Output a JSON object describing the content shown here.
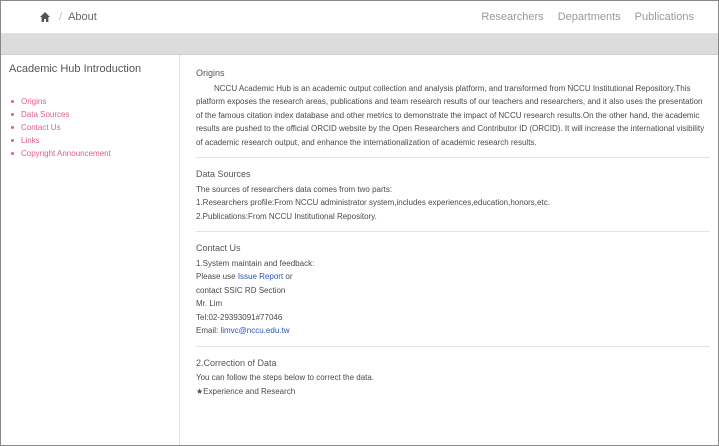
{
  "header": {
    "icons": {
      "home": "home-icon"
    },
    "breadcrumb_sep": "/",
    "breadcrumb": "About",
    "nav": [
      "Researchers",
      "Departments",
      "Publications"
    ]
  },
  "sidebar": {
    "title": "Academic Hub Introduction",
    "items": [
      {
        "label": "Origins"
      },
      {
        "label": "Data Sources"
      },
      {
        "label": "Contact Us"
      },
      {
        "label": "Links"
      },
      {
        "label": "Copyright Announcement"
      }
    ],
    "link_color": "#e05a93"
  },
  "sections": {
    "origins": {
      "title": "Origins",
      "text": "NCCU Academic Hub is an academic output collection and analysis platform, and transformed from NCCU Institutional Repository.This platform exposes the research areas, publications and team research results of our teachers and researchers, and it also uses the presentation of the famous citation index database and other metrics to demonstrate the impact of NCCU research results.On the other hand, the academic results are pushed to the official ORCID website by the Open Researchers and Contributor ID (ORCID). It will increase the international visibility of academic research output, and enhance the internationalization of academic research results."
    },
    "data_sources": {
      "title": "Data Sources",
      "lines": [
        "The sources of researchers data comes from two parts:",
        "1.Researchers profile:From NCCU administrator system,includes experiences,education,honors,etc.",
        "2.Publications:From NCCU Institutional Repository."
      ]
    },
    "contact": {
      "title": "Contact Us",
      "line1": "1.System maintain and feedback:",
      "use_prefix": "Please use ",
      "issue_link": "Issue Report",
      "use_suffix": " or",
      "line3": "contact SSIC RD Section",
      "line4": "Mr. Lim",
      "line5": "Tel:02-29393091#77046",
      "email_prefix": "Email: ",
      "email": "limvc@nccu.edu.tw"
    },
    "correction": {
      "title": "2.Correction of Data",
      "line1": "You can follow the steps below to correct the data.",
      "line2": "★Experience and Research"
    }
  },
  "colors": {
    "link": "#2b54b8",
    "band": "#dcdcdc"
  }
}
